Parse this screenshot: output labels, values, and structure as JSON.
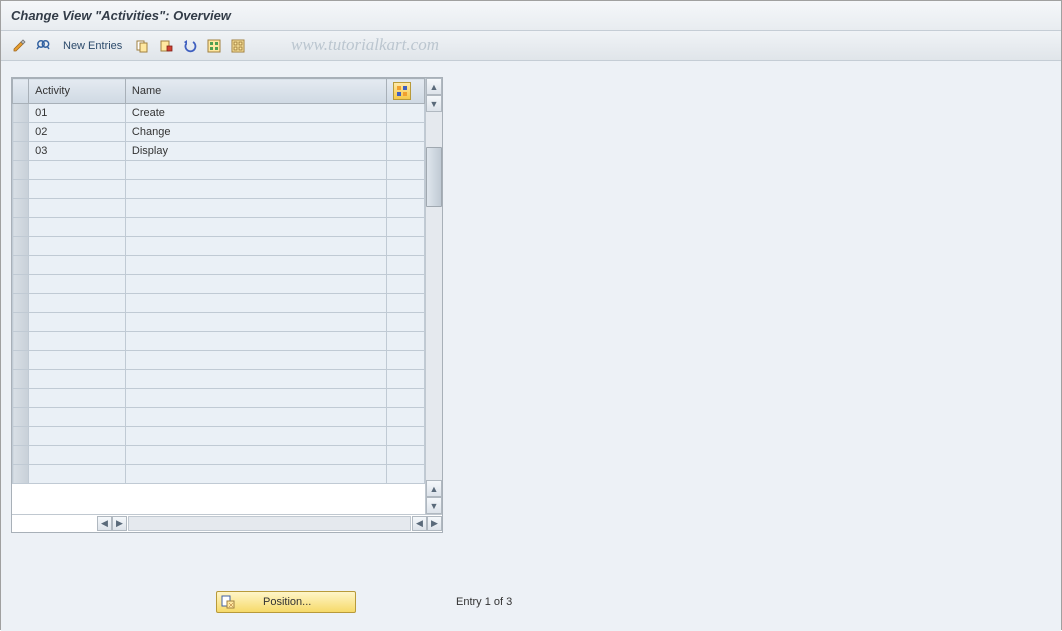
{
  "header": {
    "title": "Change View \"Activities\": Overview"
  },
  "toolbar": {
    "new_entries_label": "New Entries",
    "icons": {
      "toggle": "toggle-icon",
      "glasses": "glasses-icon",
      "copy": "copy-icon",
      "save": "save-icon",
      "undo": "undo-icon",
      "select_all": "select-all-icon",
      "deselect_all": "deselect-all-icon"
    }
  },
  "watermark": "www.tutorialkart.com",
  "table": {
    "columns": {
      "activity": "Activity",
      "name": "Name"
    },
    "rows": [
      {
        "activity": "01",
        "name": "Create"
      },
      {
        "activity": "02",
        "name": "Change"
      },
      {
        "activity": "03",
        "name": "Display"
      },
      {
        "activity": "",
        "name": ""
      },
      {
        "activity": "",
        "name": ""
      },
      {
        "activity": "",
        "name": ""
      },
      {
        "activity": "",
        "name": ""
      },
      {
        "activity": "",
        "name": ""
      },
      {
        "activity": "",
        "name": ""
      },
      {
        "activity": "",
        "name": ""
      },
      {
        "activity": "",
        "name": ""
      },
      {
        "activity": "",
        "name": ""
      },
      {
        "activity": "",
        "name": ""
      },
      {
        "activity": "",
        "name": ""
      },
      {
        "activity": "",
        "name": ""
      },
      {
        "activity": "",
        "name": ""
      },
      {
        "activity": "",
        "name": ""
      },
      {
        "activity": "",
        "name": ""
      },
      {
        "activity": "",
        "name": ""
      },
      {
        "activity": "",
        "name": ""
      }
    ]
  },
  "footer": {
    "position_label": "Position...",
    "status": "Entry 1 of 3"
  }
}
